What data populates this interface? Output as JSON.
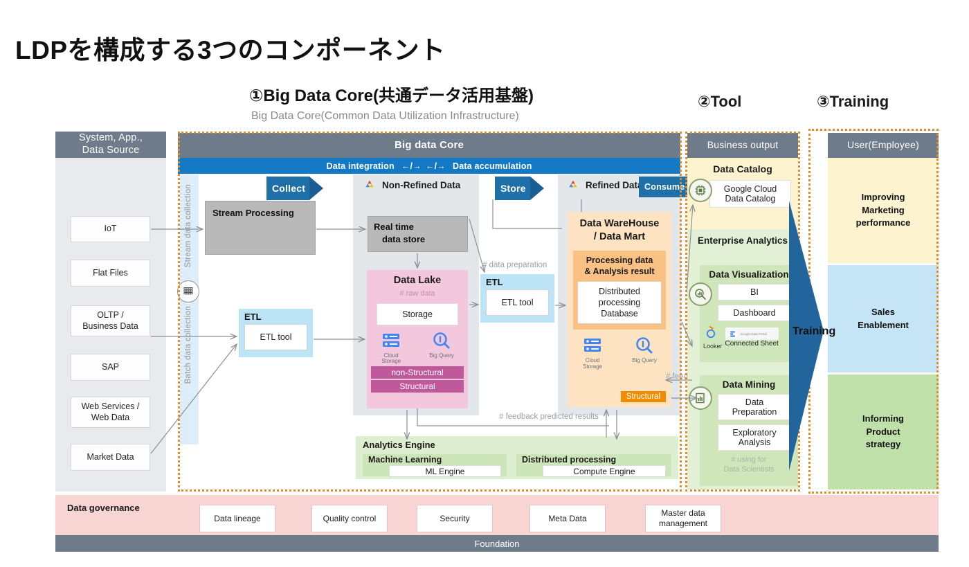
{
  "slide": {
    "title": "LDPを構成する3つのコンポーネント",
    "section1_title": "①Big Data Core(共通データ活用基盤)",
    "section1_subtitle": "Big Data Core(Common Data Utilization Infrastructure)",
    "section2_title": "②Tool",
    "section3_title": "③Training"
  },
  "colors": {
    "header_gray": "#6e7b8b",
    "accent_blue": "#1479c4",
    "dotted_orange": "#e08c2b",
    "datalake_pink": "#f3c8dd",
    "dwh_orange": "#fde3c2",
    "catalog_yellow": "#fdf4cf",
    "analytics_green": "#ddeed1",
    "governance_pink": "#f8d4d2"
  },
  "source_column": {
    "header": "System, App.,\nData Source",
    "header_line1": "System, App.,",
    "header_line2": "Data Source",
    "items": [
      {
        "label": "IoT"
      },
      {
        "label": "Flat Files"
      },
      {
        "label": "OLTP /\nBusiness Data",
        "l1": "OLTP /",
        "l2": "Business Data"
      },
      {
        "label": "SAP"
      },
      {
        "label": "Web Services /\nWeb Data",
        "l1": "Web Services /",
        "l2": "Web Data"
      },
      {
        "label": "Market Data"
      }
    ]
  },
  "big_data_core": {
    "header": "Big data Core",
    "band_left": "Data integration",
    "band_sep1": "←/→",
    "band_sep2": "←/→",
    "band_right": "Data accumulation",
    "collection_labels": {
      "stream": "Stream data collection",
      "batch": "Batch data collection"
    },
    "chevrons": {
      "collect": "Collect",
      "store": "Store",
      "consume": "Consume"
    },
    "panels": {
      "non_refined": "Non-Refined Data",
      "refined": "Refined Data"
    },
    "stream_processing": "Stream Processing",
    "realtime_store_l1": "Real time",
    "realtime_store_l2": "data store",
    "etl_left": {
      "title": "ETL",
      "tool": "ETL tool"
    },
    "etl_right": {
      "title": "ETL",
      "tool": "ETL tool",
      "note": "# data preparation"
    },
    "data_lake": {
      "title": "Data Lake",
      "note": "# raw data",
      "storage": "Storage",
      "icons": [
        {
          "name": "Cloud Storage",
          "l1": "Cloud",
          "l2": "Storage"
        },
        {
          "name": "Big Query",
          "l1": "Big Query",
          "l2": ""
        }
      ],
      "tags": [
        "non-Structural",
        "Structural"
      ]
    },
    "data_warehouse": {
      "title_l1": "Data WareHouse",
      "title_l2": "/ Data Mart",
      "inner_title_l1": "Processing data",
      "inner_title_l2": "& Analysis result",
      "inner_box": "Distributed\nprocessing\nDatabase",
      "inner_box_l1": "Distributed",
      "inner_box_l2": "processing",
      "inner_box_l3": "Database",
      "icons": [
        {
          "name": "Cloud Storage",
          "l1": "Cloud",
          "l2": "Storage"
        },
        {
          "name": "Big Query",
          "l1": "Big Query",
          "l2": ""
        }
      ],
      "tag": "Structural"
    },
    "analytics_engine": {
      "title": "Analytics Engine",
      "machine_learning": {
        "title": "Machine Learning",
        "value": "ML Engine"
      },
      "distributed": {
        "title": "Distributed processing",
        "value": "Compute Engine"
      }
    },
    "notes": {
      "feedback_predicted": "# feedback predicted results",
      "feedback_analysis": "# feedback analysis results"
    }
  },
  "business_output": {
    "header": "Business output",
    "data_catalog": {
      "title": "Data Catalog",
      "item_l1": "Google Cloud",
      "item_l2": "Data Catalog"
    },
    "enterprise_analytics": {
      "title": "Enterprise Analytics",
      "data_visualization": {
        "title": "Data Visualization",
        "items": [
          "BI",
          "Dashboard"
        ],
        "vendors": [
          {
            "label": "Looker"
          },
          {
            "label": "Connected Sheet",
            "badge": "Google Data Portal"
          }
        ]
      },
      "data_mining": {
        "title": "Data Mining",
        "items": [
          {
            "l1": "Data",
            "l2": "Preparation"
          },
          {
            "l1": "Exploratory",
            "l2": "Analysis"
          }
        ],
        "note_l1": "# using for",
        "note_l2": "Data Scientists"
      }
    }
  },
  "training": {
    "label": "Training"
  },
  "user_column": {
    "header": "User(Employee)",
    "items": [
      {
        "l1": "Improving",
        "l2": "Marketing",
        "l3": "performance",
        "color": "#fdf4cf"
      },
      {
        "l1": "Sales",
        "l2": "Enablement",
        "l3": "",
        "color": "#c5e5f7"
      },
      {
        "l1": "Informing",
        "l2": "Product",
        "l3": "strategy",
        "color": "#bfe0a8"
      }
    ]
  },
  "governance": {
    "title": "Data governance",
    "items": [
      {
        "l1": "Data lineage",
        "l2": ""
      },
      {
        "l1": "Quality control",
        "l2": ""
      },
      {
        "l1": "Security",
        "l2": ""
      },
      {
        "l1": "Meta Data",
        "l2": ""
      },
      {
        "l1": "Master data",
        "l2": "management"
      }
    ],
    "foundation": "Foundation"
  }
}
